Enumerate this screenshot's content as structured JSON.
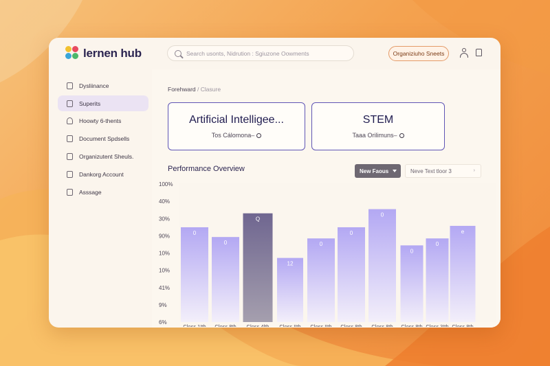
{
  "app": {
    "name": "lernen hub",
    "logo_colors": [
      "#f2c12e",
      "#e84a5f",
      "#3aa6d8",
      "#4cb86b"
    ]
  },
  "header": {
    "search_placeholder": "Search usonts, Nidrution : Sgiuzone Oowments",
    "org_button": "Organiziuho Sneets",
    "icons": [
      "search-icon",
      "user-icon",
      "bell-icon"
    ]
  },
  "sidebar": {
    "items": [
      {
        "label": "Dysliinance",
        "icon": "dashboard-icon",
        "active": false
      },
      {
        "label": "Superits",
        "icon": "reports-icon",
        "active": true
      },
      {
        "label": "Hoowty 6-thents",
        "icon": "person-icon",
        "active": false
      },
      {
        "label": "Document Spdsells",
        "icon": "document-icon",
        "active": false
      },
      {
        "label": "Organizutent Sheuls.",
        "icon": "clipboard-icon",
        "active": false
      },
      {
        "label": "Dankorg Account",
        "icon": "account-icon",
        "active": false
      },
      {
        "label": "Asssage",
        "icon": "message-icon",
        "active": false
      }
    ]
  },
  "breadcrumb": {
    "first": "Forehward",
    "separator": "/",
    "second": "Clasure"
  },
  "cards": [
    {
      "title": "Artificial Intelligee...",
      "subtitle": "Tos Cálomona–"
    },
    {
      "title": "STEM",
      "subtitle": "Taaa Orilimuns–"
    }
  ],
  "performance": {
    "title": "Performance Overview",
    "filter_button": "New Faous",
    "view_select": "Neve   Text tloor 3",
    "view_caret": "›"
  },
  "colors": {
    "accent": "#5f55b5",
    "bar": "#b3a8f3",
    "bar_highlight": "#6f6690"
  },
  "chart_data": {
    "type": "bar",
    "y_tick_labels": [
      "100%",
      "40%",
      "30%",
      "90%",
      "10%",
      "10%",
      "41%",
      "9%",
      "6%"
    ],
    "categories": [
      "Closs 1Ith",
      "Closs 8th",
      "Closs 4lth",
      "Closs IIth",
      "Closs IIth",
      "Closs 8th",
      "Closs 8th",
      "Closs 8th",
      "Closs 3Ith",
      "Closs 8th"
    ],
    "values": [
      68,
      61,
      78,
      46,
      60,
      68,
      81,
      55,
      60,
      69
    ],
    "value_labels": [
      "0",
      "0",
      "Q",
      "12",
      "0",
      "0",
      "0",
      "0",
      "0",
      "e"
    ],
    "highlight_index": 2,
    "ylim": [
      0,
      100
    ],
    "grid": false
  }
}
